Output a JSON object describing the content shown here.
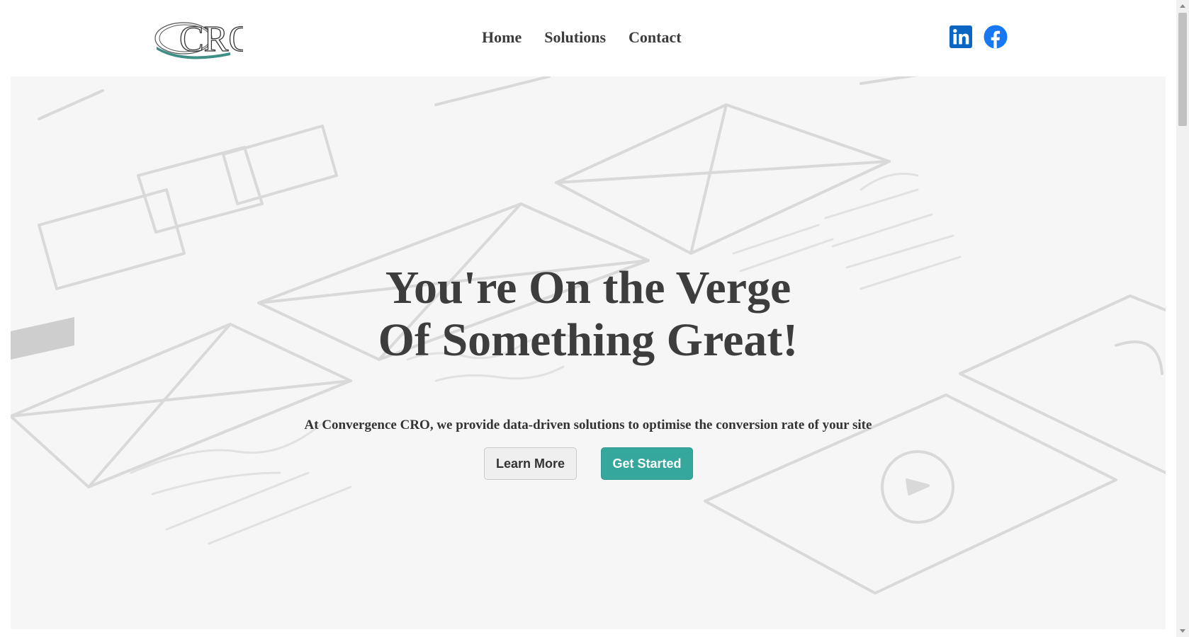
{
  "header": {
    "logo_text": "CRO",
    "nav": [
      {
        "label": "Home"
      },
      {
        "label": "Solutions"
      },
      {
        "label": "Contact"
      }
    ],
    "social": [
      {
        "name": "linkedin-icon",
        "color": "#0a66c2"
      },
      {
        "name": "facebook-icon",
        "color": "#1877f2"
      }
    ]
  },
  "hero": {
    "title_line1": "You're On the Verge",
    "title_line2": "Of Something Great!",
    "subtitle": "At Convergence CRO, we provide data-driven solutions to optimise the conversion rate of your site",
    "learn_more_label": "Learn More",
    "get_started_label": "Get Started",
    "accent_color": "#35a79c"
  }
}
